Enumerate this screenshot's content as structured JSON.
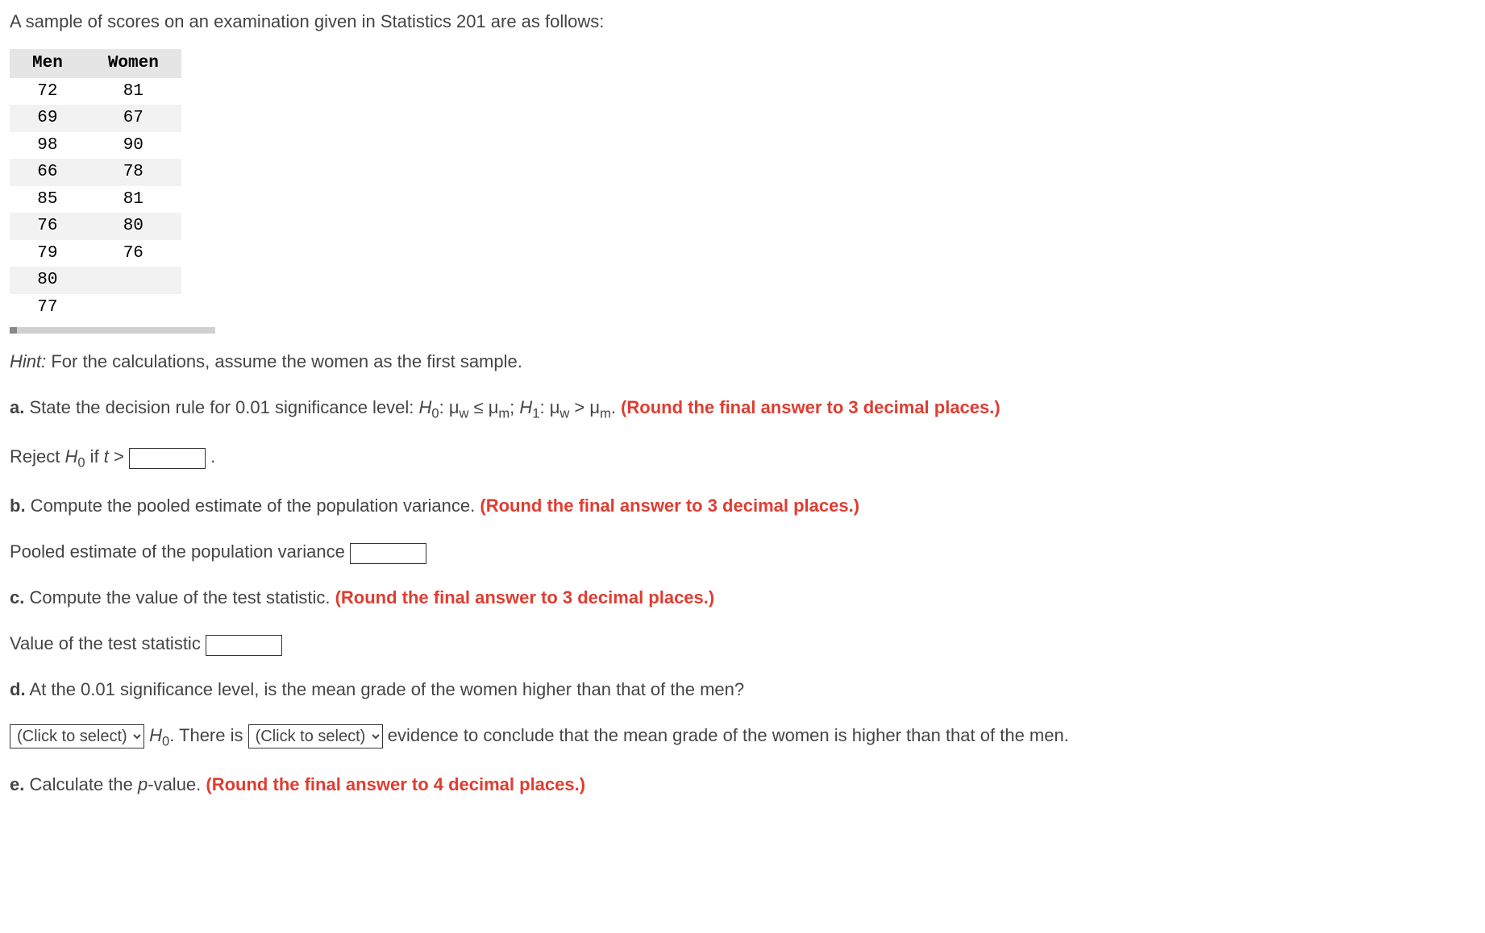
{
  "intro": "A sample of scores on an examination given in Statistics 201 are as follows:",
  "table": {
    "headers": [
      "Men",
      "Women"
    ],
    "rows": [
      [
        "72",
        "81"
      ],
      [
        "69",
        "67"
      ],
      [
        "98",
        "90"
      ],
      [
        "66",
        "78"
      ],
      [
        "85",
        "81"
      ],
      [
        "76",
        "80"
      ],
      [
        "79",
        "76"
      ],
      [
        "80",
        ""
      ],
      [
        "77",
        ""
      ]
    ]
  },
  "hint": {
    "label": "Hint:",
    "text": " For the calculations, assume the women as the first sample."
  },
  "qa": {
    "label": "a.",
    "text": " State the decision rule for 0.01 significance level: ",
    "hyp_h0_label": "H",
    "hyp_h0_sub": "0",
    "hyp_h0_text": ": μ",
    "hyp_h0_sub2": "w",
    "hyp_h0_op": " ≤ μ",
    "hyp_h0_sub3": "m",
    "hyp_sep": "; ",
    "hyp_h1_label": "H",
    "hyp_h1_sub": "1",
    "hyp_h1_text": ": μ",
    "hyp_h1_sub2": "w",
    "hyp_h1_op": " > μ",
    "hyp_h1_sub3": "m",
    "hyp_end": ". ",
    "note": "(Round the final answer to 3 decimal places.)"
  },
  "qa_answer": {
    "prefix": "Reject ",
    "h0_label": "H",
    "h0_sub": "0",
    "middle": " if ",
    "t_label": "t",
    "suffix": " > ",
    "period": " ."
  },
  "qb": {
    "label": "b.",
    "text": " Compute the pooled estimate of the population variance. ",
    "note": "(Round the final answer to 3 decimal places.)"
  },
  "qb_answer": {
    "prefix": "Pooled estimate of the population variance "
  },
  "qc": {
    "label": "c.",
    "text": " Compute the value of the test statistic. ",
    "note": "(Round the final answer to 3 decimal places.)"
  },
  "qc_answer": {
    "prefix": "Value of the test statistic "
  },
  "qd": {
    "label": "d.",
    "text": " At the 0.01 significance level, is the mean grade of the women higher than that of the men?"
  },
  "qd_answer": {
    "select1_placeholder": "(Click to select)",
    "h0_label": " H",
    "h0_sub": "0",
    "middle": ". There is ",
    "select2_placeholder": "(Click to select)",
    "suffix": " evidence to conclude that the mean grade of the women is higher than that of the men."
  },
  "qe": {
    "label": "e.",
    "text": " Calculate the ",
    "p_label": "p",
    "text2": "-value. ",
    "note": "(Round the final answer to 4 decimal places.)"
  }
}
